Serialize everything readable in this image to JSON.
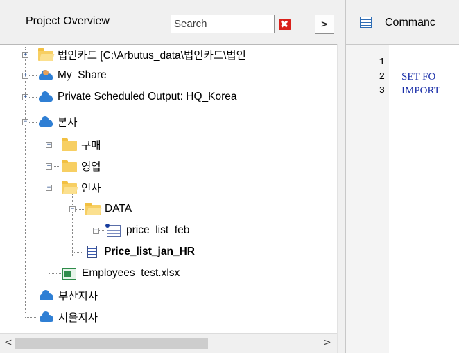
{
  "left_panel": {
    "title": "Project Overview",
    "search_placeholder": "Search",
    "clear_button_glyph": "✖",
    "collapse_button_glyph": ">"
  },
  "tree": [
    {
      "label": "법인카드 [C:\\Arbutus_data\\법인카드\\법인",
      "icon": "folder-icon",
      "expander": "+"
    },
    {
      "label": "My_Share",
      "icon": "user-share-icon",
      "expander": "+"
    },
    {
      "label": "Private Scheduled Output:  HQ_Korea",
      "icon": "cloud-icon",
      "expander": "+"
    },
    {
      "label": "본사",
      "icon": "cloud-icon",
      "expander": "−"
    },
    {
      "label": "구매",
      "icon": "folder-icon",
      "expander": "+"
    },
    {
      "label": "영업",
      "icon": "folder-icon",
      "expander": "+"
    },
    {
      "label": "인사",
      "icon": "folder-open-icon",
      "expander": "−"
    },
    {
      "label": "DATA",
      "icon": "folder-open-icon",
      "expander": "−"
    },
    {
      "label": "price_list_feb",
      "icon": "table-icon",
      "expander": "+"
    },
    {
      "label": "Price_list_jan_HR",
      "icon": "command-doc-icon",
      "bold": true
    },
    {
      "label": "Employees_test.xlsx",
      "icon": "excel-icon"
    },
    {
      "label": "부산지사",
      "icon": "cloud-icon"
    },
    {
      "label": "서울지사",
      "icon": "cloud-icon"
    }
  ],
  "scrollbar": {
    "left_arrow": "<",
    "right_arrow": ">"
  },
  "right_panel": {
    "title": "Commanc",
    "line_numbers": [
      "1",
      "2",
      "3"
    ],
    "code_lines": [
      "",
      "SET FO",
      "IMPORT"
    ]
  },
  "colors": {
    "accent_blue": "#2f7fd4",
    "folder_yellow": "#f7cf63",
    "clear_red": "#d9201a",
    "code_blue": "#1a2fa8"
  }
}
